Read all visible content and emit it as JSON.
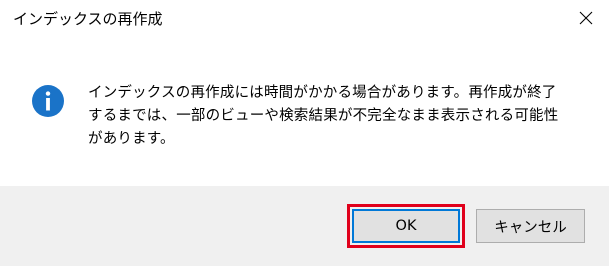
{
  "window": {
    "title": "インデックスの再作成",
    "close_icon": "close-icon"
  },
  "message": {
    "icon": "info-icon",
    "icon_color": "#1a73c8",
    "lines": [
      "インデックスの再作成には時間がかかる場合があります。再作成が終了",
      "するまでは、一部のビューや検索結果が不完全なまま表示される可能性",
      "があります。"
    ]
  },
  "buttons": {
    "ok_label": "OK",
    "cancel_label": "キャンセル",
    "highlight_color": "#e0001b"
  }
}
